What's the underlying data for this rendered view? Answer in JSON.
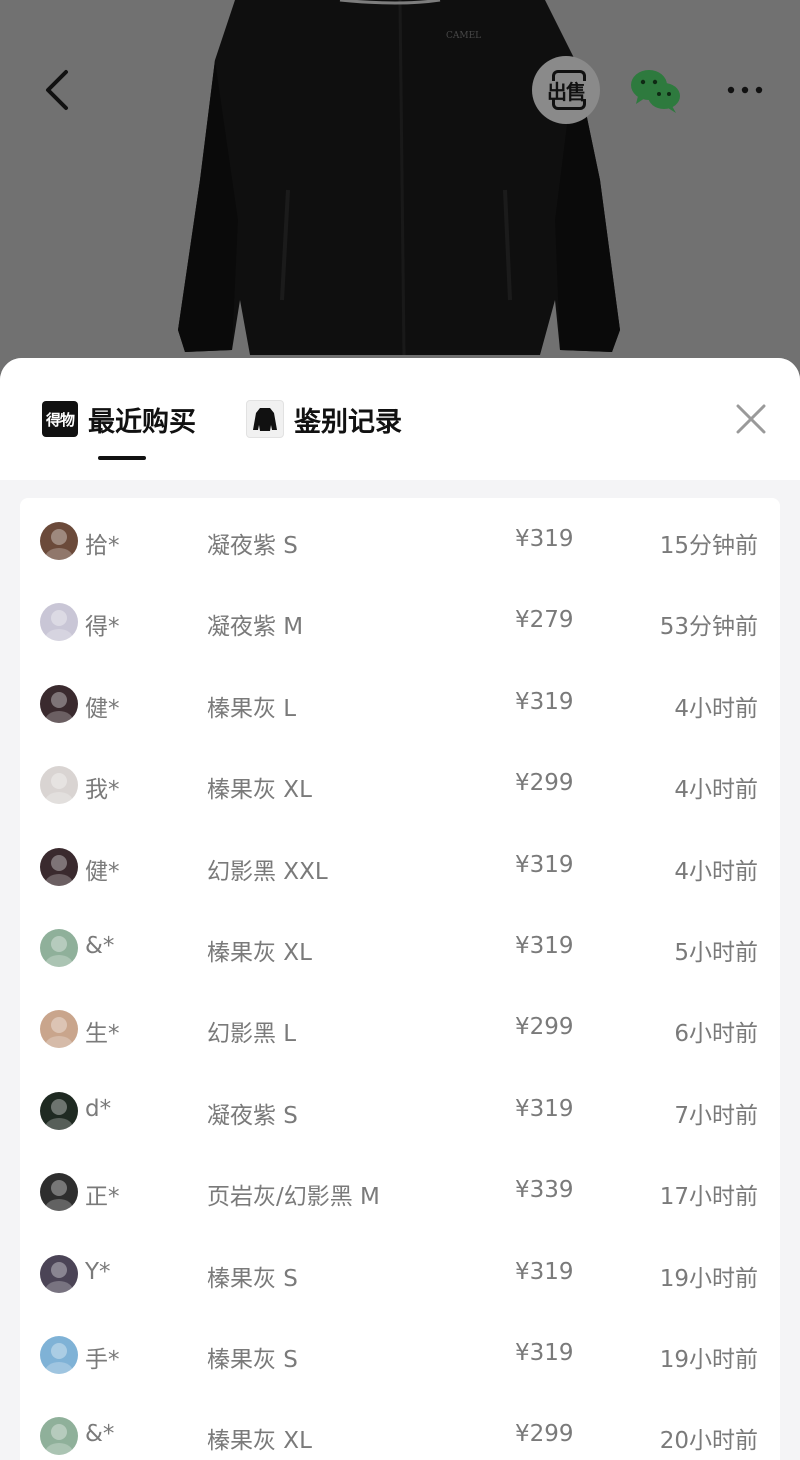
{
  "header": {
    "sell_label": "出售",
    "icons": {
      "back": "back-arrow-icon",
      "sell": "sell-icon",
      "share": "wechat-icon",
      "more": "more-dots-icon"
    }
  },
  "product_image": {
    "brand_text": "CAMEL"
  },
  "sheet": {
    "tabs": [
      {
        "label": "最近购买",
        "icon": "dewu-logo-icon",
        "icon_text": "得物",
        "active": true
      },
      {
        "label": "鉴别记录",
        "icon": "jacket-thumb-icon",
        "active": false
      }
    ],
    "close_icon": "close-icon"
  },
  "records": [
    {
      "name": "拾*",
      "spec": "凝夜紫 S",
      "price": "¥319",
      "time": "15分钟前",
      "avatar_color": "#6b4a3a"
    },
    {
      "name": "得*",
      "spec": "凝夜紫 M",
      "price": "¥279",
      "time": "53分钟前",
      "avatar_color": "#c9c6d6"
    },
    {
      "name": "健*",
      "spec": "榛果灰 L",
      "price": "¥319",
      "time": "4小时前",
      "avatar_color": "#3a2a2e"
    },
    {
      "name": "我*",
      "spec": "榛果灰 XL",
      "price": "¥299",
      "time": "4小时前",
      "avatar_color": "#d9d4d2"
    },
    {
      "name": "健*",
      "spec": "幻影黑 XXL",
      "price": "¥319",
      "time": "4小时前",
      "avatar_color": "#3a2a2e"
    },
    {
      "name": "&*",
      "spec": "榛果灰 XL",
      "price": "¥319",
      "time": "5小时前",
      "avatar_color": "#8fb09a"
    },
    {
      "name": "生*",
      "spec": "幻影黑 L",
      "price": "¥299",
      "time": "6小时前",
      "avatar_color": "#c9a58c"
    },
    {
      "name": "d*",
      "spec": "凝夜紫 S",
      "price": "¥319",
      "time": "7小时前",
      "avatar_color": "#1f2a22"
    },
    {
      "name": "正*",
      "spec": "页岩灰/幻影黑 M",
      "price": "¥339",
      "time": "17小时前",
      "avatar_color": "#2e2e2e"
    },
    {
      "name": "Y*",
      "spec": "榛果灰 S",
      "price": "¥319",
      "time": "19小时前",
      "avatar_color": "#4b4456"
    },
    {
      "name": "手*",
      "spec": "榛果灰 S",
      "price": "¥319",
      "time": "19小时前",
      "avatar_color": "#7fb2d6"
    },
    {
      "name": "&*",
      "spec": "榛果灰 XL",
      "price": "¥299",
      "time": "20小时前",
      "avatar_color": "#8fb09a"
    }
  ],
  "colors": {
    "wechat_green": "#2aae67",
    "text_gray": "#7a7a7a",
    "title_black": "#111111"
  }
}
